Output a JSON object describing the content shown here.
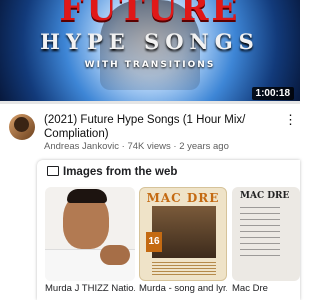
{
  "video": {
    "thumbnail": {
      "title_text": "FUTURE",
      "subtitle_text": "HYPE SONGS",
      "small_text": "WITH TRANSITIONS"
    },
    "duration": "1:00:18",
    "progress": 0.0,
    "title": "(2021) Future Hype Songs (1 Hour Mix/ Compliation)",
    "channel": "Andreas Jankovic",
    "views": "74K views",
    "age": "2 years ago",
    "meta_separator": " · ",
    "more_icon": "⋮"
  },
  "images_card": {
    "header": "Images from the web",
    "header_icon": "image-icon",
    "tiles": [
      {
        "caption": "Murda J THIZZ Natio..."
      },
      {
        "caption": "Murda - song and lyr...",
        "brand": "MAC DRE",
        "badge": "16"
      },
      {
        "caption": "Mac Dre",
        "brand": "MAC DRE"
      }
    ]
  }
}
